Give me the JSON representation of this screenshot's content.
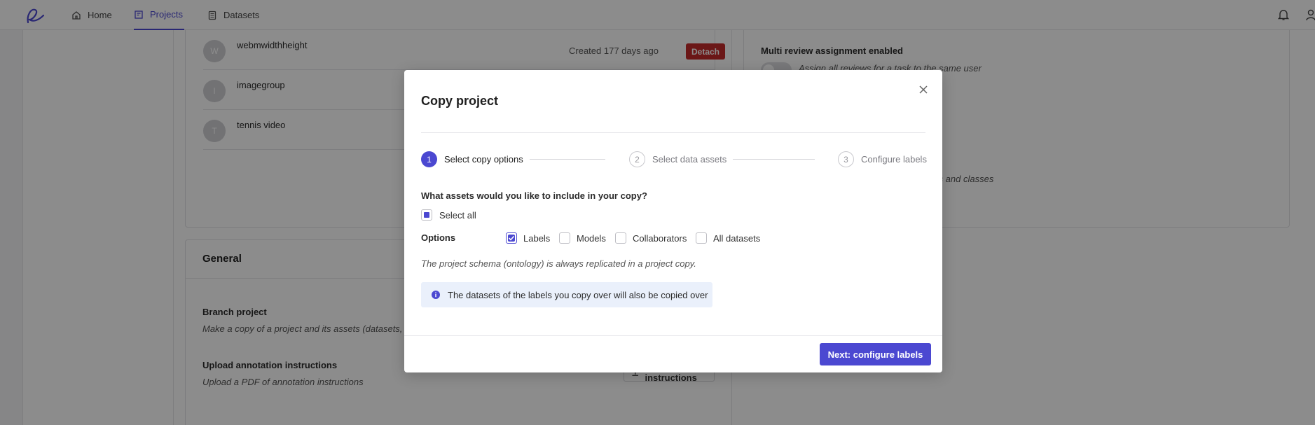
{
  "nav": {
    "home": "Home",
    "projects": "Projects",
    "datasets": "Datasets"
  },
  "collaborators": [
    {
      "initial": "W",
      "name": "webmwidthheight",
      "created": "Created 177 days ago",
      "action": "Detach"
    },
    {
      "initial": "I",
      "name": "imagegroup"
    },
    {
      "initial": "T",
      "name": "tennis video"
    }
  ],
  "general": {
    "title": "General",
    "branch_title": "Branch project",
    "branch_desc": "Make a copy of a project and its assets (datasets, m",
    "upload_title": "Upload annotation instructions",
    "upload_desc": "Upload a PDF of annotation instructions",
    "add_instructions": "Add instructions"
  },
  "right_panel": {
    "title": "Multi review assignment enabled",
    "desc": "Assign all reviews for a task to the same user",
    "desc2": "ors and classes"
  },
  "modal": {
    "title": "Copy project",
    "steps": [
      {
        "num": "1",
        "label": "Select copy options"
      },
      {
        "num": "2",
        "label": "Select data assets"
      },
      {
        "num": "3",
        "label": "Configure labels"
      }
    ],
    "question": "What assets would you like to include in your copy?",
    "select_all": "Select all",
    "options_label": "Options",
    "options": [
      "Labels",
      "Models",
      "Collaborators",
      "All datasets"
    ],
    "note": "The project schema (ontology) is always replicated in a project copy.",
    "info": "The datasets of the labels you copy over will also be copied over",
    "next_button": "Next: configure labels"
  },
  "colors": {
    "accent": "#4b48d1",
    "danger": "#c42b2b",
    "info_bg": "#eaf0fb"
  }
}
